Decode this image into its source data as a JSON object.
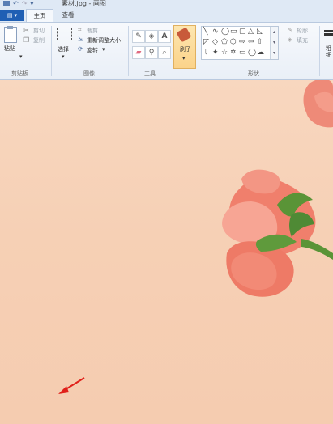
{
  "app": {
    "title": "素材.jpg - 画图"
  },
  "quick_access": {
    "icons": [
      "save-icon",
      "undo-icon",
      "redo-icon",
      "customize-icon"
    ],
    "customize_glyph": "▾"
  },
  "file_menu": {
    "label": "▤ ▾"
  },
  "tabs": [
    {
      "label": "主页",
      "active": true
    },
    {
      "label": "查看",
      "active": false
    }
  ],
  "ribbon": {
    "clipboard": {
      "paste_label": "粘贴",
      "cut_label": "剪切",
      "copy_label": "复制",
      "group_label": "剪贴板"
    },
    "image": {
      "select_label": "选择",
      "crop_label": "裁剪",
      "resize_label": "重新调整大小",
      "rotate_label": "旋转",
      "group_label": "图像"
    },
    "tools": {
      "group_label": "工具"
    },
    "brushes": {
      "label": "刷子"
    },
    "shapes": {
      "outline_label": "轮廓",
      "fill_label": "填充",
      "group_label": "形状"
    },
    "size_label": "粗细"
  },
  "colors": {
    "ribbon_bg": "#eef3f9",
    "accent_blue": "#1f5fb4",
    "canvas_bg": "#f6d0b5",
    "rose": "#f07f6c",
    "leaf": "#4f8a35",
    "arrow": "#e0201a"
  }
}
